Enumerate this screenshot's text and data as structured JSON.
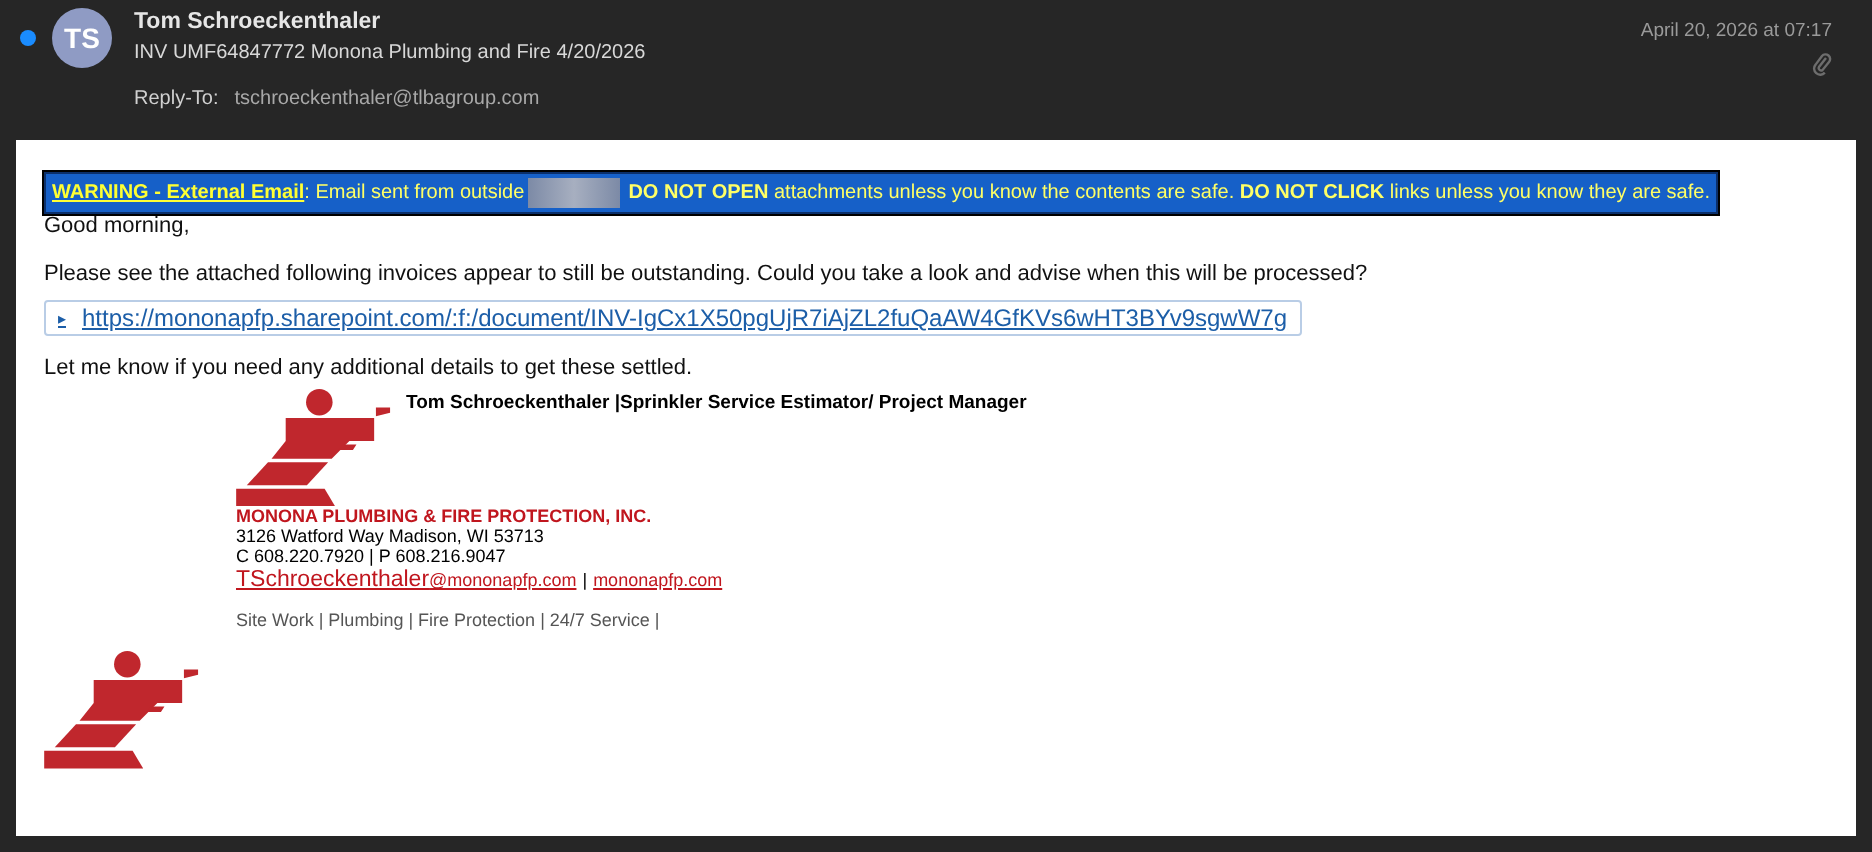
{
  "header": {
    "unread": true,
    "avatar_initials": "TS",
    "sender": "Tom Schroeckenthaler",
    "subject": "INV UMF64847772 Monona Plumbing and Fire 4/20/2026",
    "date": "April 20, 2026 at 07:17",
    "has_attachment": true,
    "reply_to_label": "Reply-To:",
    "reply_to": "tschroeckenthaler@tlbagroup.com"
  },
  "warning": {
    "link": "WARNING - External Email",
    "before_redaction": ": Email sent from outside",
    "after_redaction": "**DO NOT OPEN** attachments unless you know the contents are safe. **DO NOT CLICK** links unless you know they are safe."
  },
  "body": {
    "greeting": "Good morning,",
    "paragraph": "Please see the attached following invoices appear to still be outstanding. Could you take a look and advise when this will be processed?",
    "link_marker": "▸",
    "link": "https://mononapfp.sharepoint.com/:f:/document/INV-IgCx1X50pgUjR7iAjZL2fuQaAW4GfKVs6wHT3BYv9sgwW7g",
    "closing": "Let me know if you need any additional details to get these settled."
  },
  "signature": {
    "name_title": "Tom Schroeckenthaler |Sprinkler Service Estimator/ Project Manager",
    "company": "MONONA PLUMBING & FIRE PROTECTION, INC.",
    "address": "3126 Watford Way Madison, WI 53713",
    "phones": "C 608.220.7920 | P 608.216.9047",
    "email_user": "TSchroeckenthaler",
    "email_domain": "@mononapfp.com",
    "separator": "|",
    "website": "mononapfp.com",
    "services": "Site Work | Plumbing | Fire Protection | 24/7 Service |"
  }
}
